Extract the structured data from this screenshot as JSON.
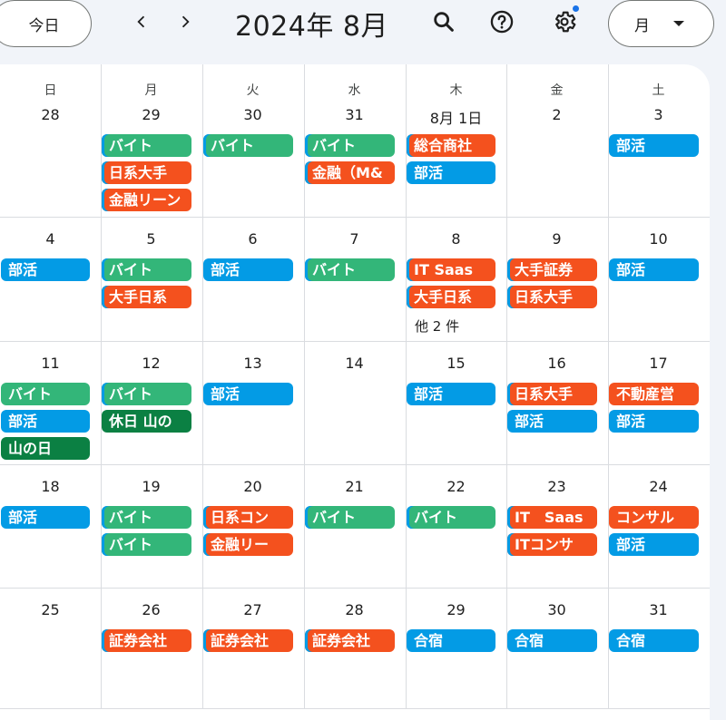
{
  "toolbar": {
    "today_label": "今日",
    "title": "2024年 8月",
    "view_label": "月",
    "prev_icon": "chevron-left-icon",
    "next_icon": "chevron-right-icon",
    "search_icon": "search-icon",
    "help_icon": "help-icon",
    "settings_icon": "gear-icon"
  },
  "colors": {
    "green": "#33b679",
    "orange": "#f4511e",
    "blue": "#039be5",
    "dark_green": "#0b8043"
  },
  "weekdays": [
    "日",
    "月",
    "火",
    "水",
    "木",
    "金",
    "土"
  ],
  "weeks": [
    {
      "days": [
        {
          "date": "28",
          "events": []
        },
        {
          "date": "29",
          "events": [
            {
              "title": "バイト",
              "color": "green"
            },
            {
              "title": "日系大手",
              "color": "orange"
            },
            {
              "title": "金融リーン",
              "color": "orange"
            }
          ]
        },
        {
          "date": "30",
          "events": [
            {
              "title": "バイト",
              "color": "green"
            }
          ]
        },
        {
          "date": "31",
          "events": [
            {
              "title": "バイト",
              "color": "green"
            },
            {
              "title": "金融（M&",
              "color": "orange"
            }
          ]
        },
        {
          "date": "8月 1日",
          "events": [
            {
              "title": "総合商社",
              "color": "orange"
            },
            {
              "title": "部活",
              "color": "blue"
            }
          ]
        },
        {
          "date": "2",
          "events": []
        },
        {
          "date": "3",
          "events": [
            {
              "title": "部活",
              "color": "blue"
            }
          ]
        }
      ]
    },
    {
      "days": [
        {
          "date": "4",
          "events": [
            {
              "title": "部活",
              "color": "blue"
            }
          ]
        },
        {
          "date": "5",
          "events": [
            {
              "title": "バイト",
              "color": "green"
            },
            {
              "title": "大手日系",
              "color": "orange"
            }
          ]
        },
        {
          "date": "6",
          "events": [
            {
              "title": "部活",
              "color": "blue"
            }
          ]
        },
        {
          "date": "7",
          "events": [
            {
              "title": "バイト",
              "color": "green"
            }
          ]
        },
        {
          "date": "8",
          "events": [
            {
              "title": "IT Saas",
              "color": "orange"
            },
            {
              "title": "大手日系",
              "color": "orange"
            }
          ],
          "more": "他 2 件"
        },
        {
          "date": "9",
          "events": [
            {
              "title": "大手証券",
              "color": "orange"
            },
            {
              "title": "日系大手",
              "color": "orange"
            }
          ]
        },
        {
          "date": "10",
          "events": [
            {
              "title": "部活",
              "color": "blue"
            }
          ]
        }
      ]
    },
    {
      "days": [
        {
          "date": "11",
          "events": [
            {
              "title": "バイト",
              "color": "green"
            },
            {
              "title": "部活",
              "color": "blue"
            },
            {
              "title": "山の日",
              "color": "dgreen"
            }
          ]
        },
        {
          "date": "12",
          "events": [
            {
              "title": "バイト",
              "color": "green"
            },
            {
              "title": "休日 山の",
              "color": "dgreen"
            }
          ]
        },
        {
          "date": "13",
          "events": [
            {
              "title": "部活",
              "color": "blue"
            }
          ]
        },
        {
          "date": "14",
          "events": []
        },
        {
          "date": "15",
          "events": [
            {
              "title": "部活",
              "color": "blue"
            }
          ]
        },
        {
          "date": "16",
          "events": [
            {
              "title": "日系大手",
              "color": "orange"
            },
            {
              "title": "部活",
              "color": "blue"
            }
          ]
        },
        {
          "date": "17",
          "events": [
            {
              "title": "不動産営",
              "color": "orange"
            },
            {
              "title": "部活",
              "color": "blue"
            }
          ]
        }
      ]
    },
    {
      "days": [
        {
          "date": "18",
          "events": [
            {
              "title": "部活",
              "color": "blue"
            }
          ]
        },
        {
          "date": "19",
          "events": [
            {
              "title": "バイト",
              "color": "green"
            },
            {
              "title": "バイト",
              "color": "green"
            }
          ]
        },
        {
          "date": "20",
          "events": [
            {
              "title": "日系コン",
              "color": "orange"
            },
            {
              "title": "金融リー",
              "color": "orange"
            }
          ]
        },
        {
          "date": "21",
          "events": [
            {
              "title": "バイト",
              "color": "green"
            }
          ]
        },
        {
          "date": "22",
          "events": [
            {
              "title": "バイト",
              "color": "green"
            }
          ]
        },
        {
          "date": "23",
          "events": [
            {
              "title": "IT　Saas",
              "color": "orange"
            },
            {
              "title": "ITコンサ",
              "color": "orange"
            }
          ]
        },
        {
          "date": "24",
          "events": [
            {
              "title": "コンサル",
              "color": "orange"
            },
            {
              "title": "部活",
              "color": "blue"
            }
          ]
        }
      ]
    },
    {
      "days": [
        {
          "date": "25",
          "events": []
        },
        {
          "date": "26",
          "events": [
            {
              "title": "証券会社",
              "color": "orange"
            }
          ]
        },
        {
          "date": "27",
          "events": [
            {
              "title": "証券会社",
              "color": "orange"
            }
          ]
        },
        {
          "date": "28",
          "events": [
            {
              "title": "証券会社",
              "color": "orange"
            }
          ]
        },
        {
          "date": "29",
          "events": [
            {
              "title": "合宿",
              "color": "blue"
            }
          ]
        },
        {
          "date": "30",
          "events": [
            {
              "title": "合宿",
              "color": "blue"
            }
          ]
        },
        {
          "date": "31",
          "events": [
            {
              "title": "合宿",
              "color": "blue"
            }
          ]
        }
      ]
    }
  ]
}
